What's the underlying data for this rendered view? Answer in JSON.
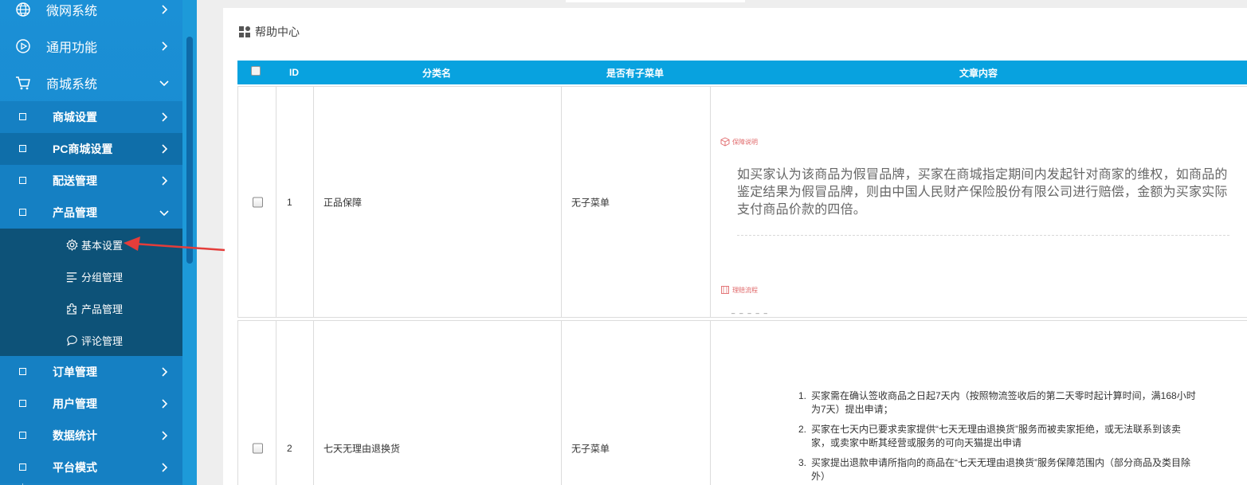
{
  "sidebar": {
    "top_items": [
      {
        "label": "微网系统",
        "icon": "globe-icon"
      },
      {
        "label": "通用功能",
        "icon": "play-circle-icon"
      },
      {
        "label": "商城系统",
        "icon": "cart-icon"
      }
    ],
    "sub_items": [
      {
        "label": "商城设置"
      },
      {
        "label": "PC商城设置"
      },
      {
        "label": "配送管理"
      },
      {
        "label": "产品管理"
      },
      {
        "label": "订单管理"
      },
      {
        "label": "用户管理"
      },
      {
        "label": "数据统计"
      },
      {
        "label": "平台模式"
      }
    ],
    "product_children": [
      {
        "label": "基本设置",
        "icon": "gear-icon"
      },
      {
        "label": "分组管理",
        "icon": "list-icon"
      },
      {
        "label": "产品管理",
        "icon": "puzzle-icon"
      },
      {
        "label": "评论管理",
        "icon": "chat-icon"
      }
    ]
  },
  "breadcrumb": {
    "title": "帮助中心",
    "icon": "grid-icon"
  },
  "table": {
    "headers": [
      "ID",
      "分类名",
      "是否有子菜单",
      "文章内容"
    ],
    "rows": [
      {
        "id": "1",
        "name": "正品保障",
        "submenu": "无子菜单",
        "tag1": "保障说明",
        "article": "如买家认为该商品为假冒品牌，买家在商城指定期间内发起针对商家的维权，如商品的鉴定结果为假冒品牌，则由中国人民财产保险股份有限公司进行赔偿，金额为买家实际支付商品价款的四倍。",
        "tag2": "理赔流程",
        "faint": "━ ━ ━ ━ ━"
      },
      {
        "id": "2",
        "name": "七天无理由退换货",
        "submenu": "无子菜单",
        "list": [
          {
            "num": "1.",
            "text": "买家需在确认签收商品之日起7天内（按照物流签收后的第二天零时起计算时间，满168小时为7天）提出申请；"
          },
          {
            "num": "2.",
            "text": "买家在七天内已要求卖家提供“七天无理由退换货”服务而被卖家拒绝，或无法联系到该卖家，或卖家中断其经营或服务的可向天猫提出申请"
          },
          {
            "num": "3.",
            "text": "买家提出退款申请所指向的商品在“七天无理由退换货”服务保障范围内（部分商品及类目除外）"
          }
        ]
      }
    ]
  },
  "colors": {
    "sidebar": "#1b90d6",
    "submenu_dark": "#0d5278",
    "header": "#08a2df",
    "arrow": "#e43d3a"
  }
}
